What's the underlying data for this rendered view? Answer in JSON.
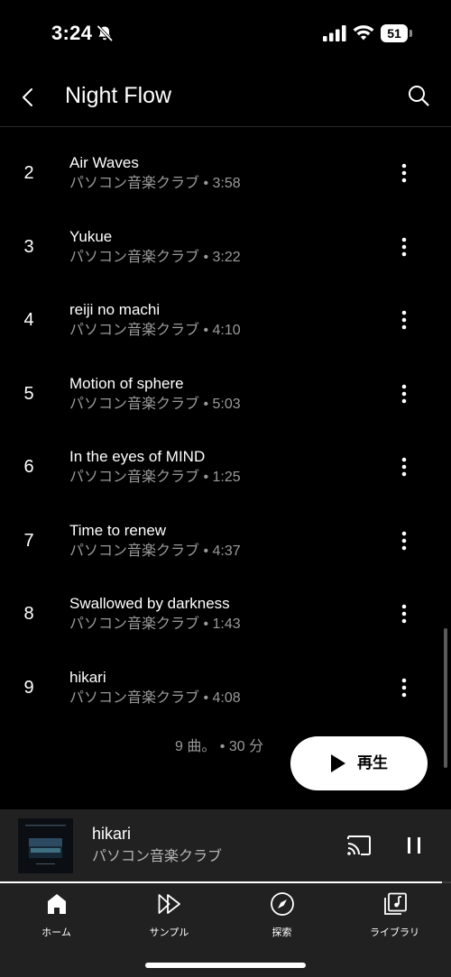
{
  "status_bar": {
    "time": "3:24",
    "battery": "51",
    "icons": [
      "bell-slash-icon",
      "cellular-signal-icon",
      "wifi-icon",
      "battery-icon"
    ]
  },
  "header": {
    "title": "Night Flow",
    "back_icon": "chevron-left-icon",
    "search_icon": "search-icon"
  },
  "tracks": [
    {
      "number": "2",
      "title": "Air Waves",
      "subtitle": "パソコン音楽クラブ • 3:58"
    },
    {
      "number": "3",
      "title": "Yukue",
      "subtitle": "パソコン音楽クラブ • 3:22"
    },
    {
      "number": "4",
      "title": "reiji no machi",
      "subtitle": "パソコン音楽クラブ • 4:10"
    },
    {
      "number": "5",
      "title": "Motion of sphere",
      "subtitle": "パソコン音楽クラブ • 5:03"
    },
    {
      "number": "6",
      "title": "In the eyes of MIND",
      "subtitle": "パソコン音楽クラブ • 1:25"
    },
    {
      "number": "7",
      "title": "Time to renew",
      "subtitle": "パソコン音楽クラブ • 4:37"
    },
    {
      "number": "8",
      "title": "Swallowed by darkness",
      "subtitle": "パソコン音楽クラブ • 1:43"
    },
    {
      "number": "9",
      "title": "hikari",
      "subtitle": "パソコン音楽クラブ • 4:08"
    }
  ],
  "summary": "9 曲。 • 30 分",
  "play_button": {
    "label": "再生",
    "icon": "play-icon"
  },
  "now_playing": {
    "title": "hikari",
    "artist": "パソコン音楽クラブ",
    "progress": 0.98,
    "icons": [
      "cast-icon",
      "pause-icon"
    ]
  },
  "nav": [
    {
      "label": "ホーム",
      "icon": "home-icon",
      "active": true
    },
    {
      "label": "サンプル",
      "icon": "samples-icon",
      "active": false
    },
    {
      "label": "探索",
      "icon": "compass-icon",
      "active": false
    },
    {
      "label": "ライブラリ",
      "icon": "library-icon",
      "active": false
    }
  ],
  "colors": {
    "background": "#000000",
    "surface": "#212121",
    "secondary_text": "#9a9a9a",
    "primary_text": "#ffffff"
  }
}
